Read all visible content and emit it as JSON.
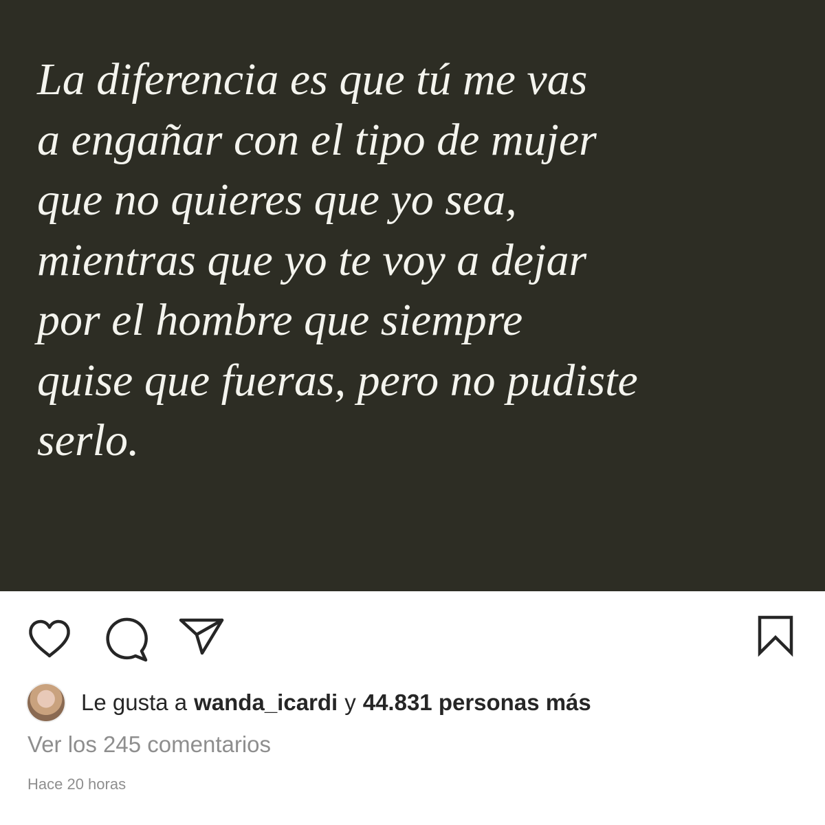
{
  "post": {
    "quote_lines": [
      "La diferencia es que tú me vas",
      "a engañar con el tipo de mujer",
      "que no quieres que yo sea,",
      "mientras que yo te voy a dejar",
      "por el hombre que siempre",
      "quise que fueras, pero no pudiste",
      "serlo."
    ],
    "background_color": "#2d2d24",
    "text_color": "#f4f4ee"
  },
  "actions": {
    "like_icon": "heart-icon",
    "comment_icon": "comment-icon",
    "share_icon": "paper-plane-icon",
    "save_icon": "bookmark-icon"
  },
  "likes": {
    "prefix": "Le gusta a",
    "user": "wanda_icardi",
    "connector": "y",
    "count_text": "44.831 personas más"
  },
  "comments": {
    "view_all": "Ver los 245 comentarios"
  },
  "timestamp": "Hace 20 horas"
}
